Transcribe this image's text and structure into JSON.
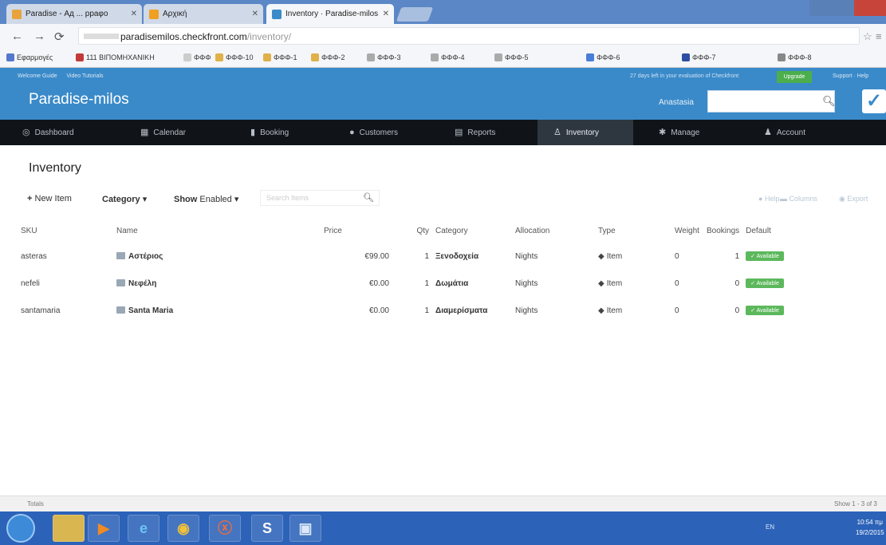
{
  "browser": {
    "tabs": [
      {
        "label": "Paradise - Ад ... ppaφο"
      },
      {
        "label": "Αρχική"
      },
      {
        "label": "Inventory · Paradise-milos"
      }
    ],
    "url_host": "paradisemilos.checkfront.com",
    "url_path": "/inventory/",
    "bookmarks": [
      "Εφαρμογές",
      "111 ΒΙΠΟΜΗΧΑΝΙΚΗ",
      "ΦΦΦ",
      "ΦΦΦ-10",
      "ΦΦΦ-1",
      "ΦΦΦ-2",
      "ΦΦΦ-3",
      "ΦΦΦ-4",
      "ΦΦΦ-5",
      "ΦΦΦ-6",
      "ΦΦΦ-7",
      "ΦΦΦ-8"
    ]
  },
  "app": {
    "guide_link": "Welcome Guide",
    "tutorials_link": "Video Tutorials",
    "trial_text": "27 days left in your evaluation of Checkfront",
    "upgrade_label": "Upgrade",
    "support_label": "Support · Help",
    "brand": "Paradise-milos",
    "user": "Anastasia",
    "colors": {
      "header": "#3a8ac9",
      "nav": "#101419",
      "badge": "#5cb85c"
    }
  },
  "nav": [
    {
      "label": "Dashboard",
      "icon": "dashboard-icon"
    },
    {
      "label": "Calendar",
      "icon": "calendar-icon"
    },
    {
      "label": "Booking",
      "icon": "booking-icon"
    },
    {
      "label": "Customers",
      "icon": "customers-icon"
    },
    {
      "label": "Reports",
      "icon": "reports-icon"
    },
    {
      "label": "Inventory",
      "icon": "inventory-icon",
      "active": true
    },
    {
      "label": "Manage",
      "icon": "manage-icon"
    },
    {
      "label": "Account",
      "icon": "account-icon"
    }
  ],
  "page": {
    "title": "Inventory",
    "new_item": "New Item",
    "category_filter": "Category",
    "show_label": "Show",
    "show_value": "Enabled",
    "search_placeholder": "Search Items",
    "help": "Help",
    "columns_btn": "Columns",
    "export_btn": "Export"
  },
  "table": {
    "headers": [
      "SKU",
      "Name",
      "Price",
      "Qty",
      "Category",
      "Allocation",
      "Type",
      "Weight",
      "Bookings",
      "Default"
    ],
    "rows": [
      {
        "sku": "asteras",
        "name": "Αστέριος",
        "price": "€99.00",
        "qty": "1",
        "category": "Ξενοδοχεία",
        "allocation": "Nights",
        "type": "Item",
        "weight": "0",
        "bookings": "1",
        "default": "Available"
      },
      {
        "sku": "nefeli",
        "name": "Νεφέλη",
        "price": "€0.00",
        "qty": "1",
        "category": "Δωμάτια",
        "allocation": "Nights",
        "type": "Item",
        "weight": "0",
        "bookings": "0",
        "default": "Available"
      },
      {
        "sku": "santamaria",
        "name": "Santa Maria",
        "price": "€0.00",
        "qty": "1",
        "category": "Διαμερίσματα",
        "allocation": "Nights",
        "type": "Item",
        "weight": "0",
        "bookings": "0",
        "default": "Available"
      }
    ]
  },
  "footer": {
    "left": "Totals",
    "right": "Show 1 - 3 of 3"
  },
  "taskbar": {
    "apps": [
      "explorer",
      "media",
      "ie",
      "chrome",
      "xampp",
      "skype",
      "other"
    ],
    "tray": "EN",
    "time": "10:54 πμ",
    "date": "19/2/2015"
  }
}
